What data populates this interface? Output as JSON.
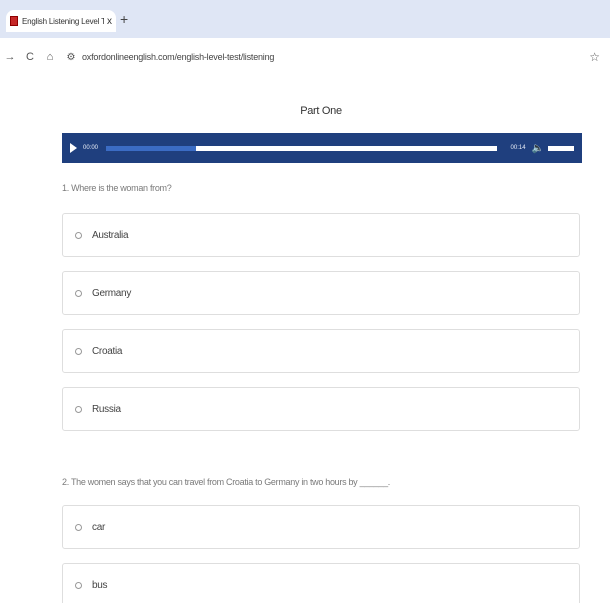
{
  "browser": {
    "tab_title": "English Listening Level Test - O",
    "tab_close": "x",
    "new_tab": "+",
    "back": "←",
    "forward": "→",
    "reload": "C",
    "home": "⌂",
    "site_info": "⚙",
    "url": "oxfordonlineenglish.com/english-level-test/listening",
    "bookmark": "☆"
  },
  "page": {
    "part_title": "Part One",
    "player": {
      "current_time": "00:00",
      "duration": "00:14",
      "progress": 0.23
    },
    "questions": [
      {
        "text": "1. Where is the woman from?",
        "options": [
          "Australia",
          "Germany",
          "Croatia",
          "Russia"
        ]
      },
      {
        "text": "2. The women says that you can travel from Croatia to Germany in two hours by ______.",
        "options": [
          "car",
          "bus"
        ]
      }
    ]
  }
}
